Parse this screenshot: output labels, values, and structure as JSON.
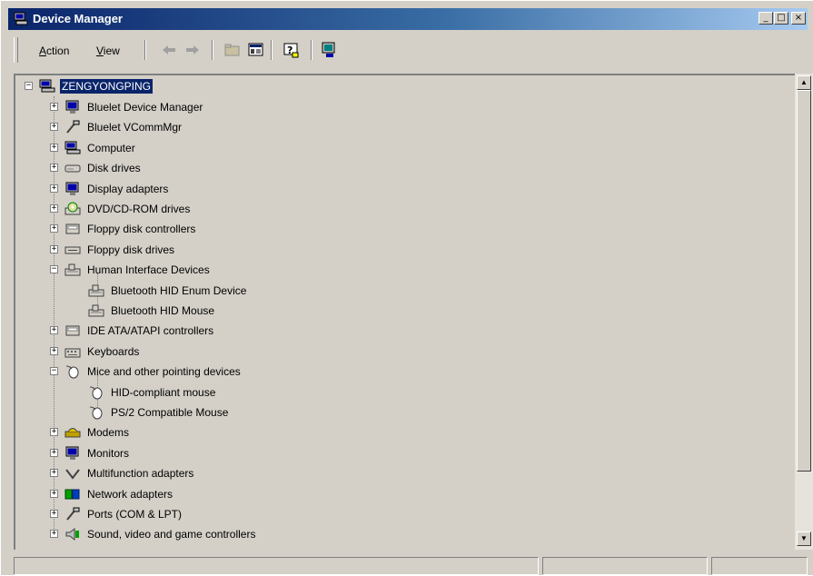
{
  "window": {
    "title": "Device Manager"
  },
  "title_buttons": {
    "minimize": "_",
    "maximize": "□",
    "close": "×"
  },
  "menu": [
    {
      "label": "Action",
      "underline": "A",
      "rest": "ction"
    },
    {
      "label": "View",
      "underline": "V",
      "rest": "iew"
    }
  ],
  "toolbar": {
    "buttons": [
      "back-arrow-icon",
      "forward-arrow-icon",
      "up-folder-icon",
      "properties-icon",
      "help-icon",
      "scan-hardware-icon"
    ]
  },
  "tree": {
    "root": {
      "label": "ZENGYONGPING",
      "icon": "computer-icon",
      "expanded": true,
      "selected": true
    },
    "items": [
      {
        "label": "Bluelet Device Manager",
        "icon": "monitor-icon",
        "expanded": false,
        "level": 1
      },
      {
        "label": "Bluelet VCommMgr",
        "icon": "port-icon",
        "expanded": false,
        "level": 1
      },
      {
        "label": "Computer",
        "icon": "computer-icon",
        "expanded": false,
        "level": 1
      },
      {
        "label": "Disk drives",
        "icon": "disk-drive-icon",
        "expanded": false,
        "level": 1
      },
      {
        "label": "Display adapters",
        "icon": "monitor-icon",
        "expanded": false,
        "level": 1
      },
      {
        "label": "DVD/CD-ROM drives",
        "icon": "cdrom-icon",
        "expanded": false,
        "level": 1
      },
      {
        "label": "Floppy disk controllers",
        "icon": "controller-icon",
        "expanded": false,
        "level": 1
      },
      {
        "label": "Floppy disk drives",
        "icon": "floppy-drive-icon",
        "expanded": false,
        "level": 1
      },
      {
        "label": "Human Interface Devices",
        "icon": "hid-icon",
        "expanded": true,
        "level": 1
      },
      {
        "label": "Bluetooth HID Enum Device",
        "icon": "hid-icon",
        "level": 2
      },
      {
        "label": "Bluetooth HID Mouse",
        "icon": "hid-icon",
        "level": 2
      },
      {
        "label": "IDE ATA/ATAPI controllers",
        "icon": "controller-icon",
        "expanded": false,
        "level": 1
      },
      {
        "label": "Keyboards",
        "icon": "keyboard-icon",
        "expanded": false,
        "level": 1
      },
      {
        "label": "Mice and other pointing devices",
        "icon": "mouse-icon",
        "expanded": true,
        "level": 1
      },
      {
        "label": "HID-compliant mouse",
        "icon": "mouse-icon",
        "level": 2
      },
      {
        "label": "PS/2 Compatible Mouse",
        "icon": "mouse-icon",
        "level": 2
      },
      {
        "label": "Modems",
        "icon": "modem-icon",
        "expanded": false,
        "level": 1
      },
      {
        "label": "Monitors",
        "icon": "monitor-icon",
        "expanded": false,
        "level": 1
      },
      {
        "label": "Multifunction adapters",
        "icon": "multifunction-icon",
        "expanded": false,
        "level": 1
      },
      {
        "label": "Network adapters",
        "icon": "network-icon",
        "expanded": false,
        "level": 1
      },
      {
        "label": "Ports (COM & LPT)",
        "icon": "port-icon",
        "expanded": false,
        "level": 1
      },
      {
        "label": "Sound, video and game controllers",
        "icon": "sound-icon",
        "expanded": false,
        "level": 1
      }
    ]
  },
  "colors": {
    "titlebar_start": "#0a246a",
    "titlebar_end": "#a6caf0",
    "selection": "#0a246a",
    "face": "#d4d0c8"
  }
}
